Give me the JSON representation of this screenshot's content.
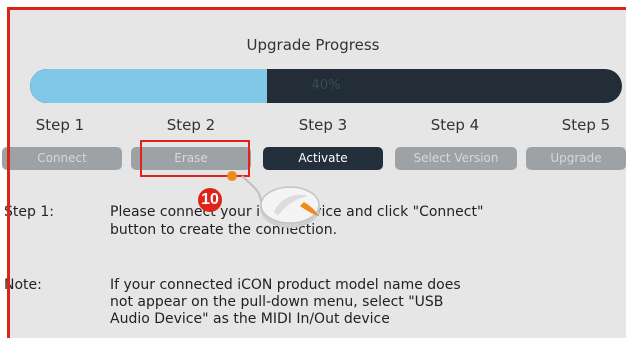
{
  "title": "Upgrade Progress",
  "progress": {
    "value": 40,
    "label": "40%"
  },
  "steps": [
    {
      "label": "Step 1",
      "button": "Connect"
    },
    {
      "label": "Step 2",
      "button": "Erase"
    },
    {
      "label": "Step 3",
      "button": "Activate"
    },
    {
      "label": "Step 4",
      "button": "Select Version"
    },
    {
      "label": "Step 5",
      "button": "Upgrade"
    }
  ],
  "active_step": 3,
  "callout": {
    "number": "10"
  },
  "instructions": {
    "step1_label": "Step 1:",
    "step1_line1": "Please connect your iCON device and click \"Connect\"",
    "step1_line2": "button to create the connection.",
    "note_label": "Note:",
    "note_line1": "If your connected iCON product model name does",
    "note_line2": "not appear on the pull-down menu, select \"USB",
    "note_line3": "Audio Device\" as the MIDI In/Out device"
  },
  "colors": {
    "frame": "#d9261c",
    "progress_fill": "#80c8e8",
    "progress_track": "#222d38",
    "active_button": "#232f3b",
    "inactive_button": "#9da2a6",
    "callout": "#e0231a"
  }
}
